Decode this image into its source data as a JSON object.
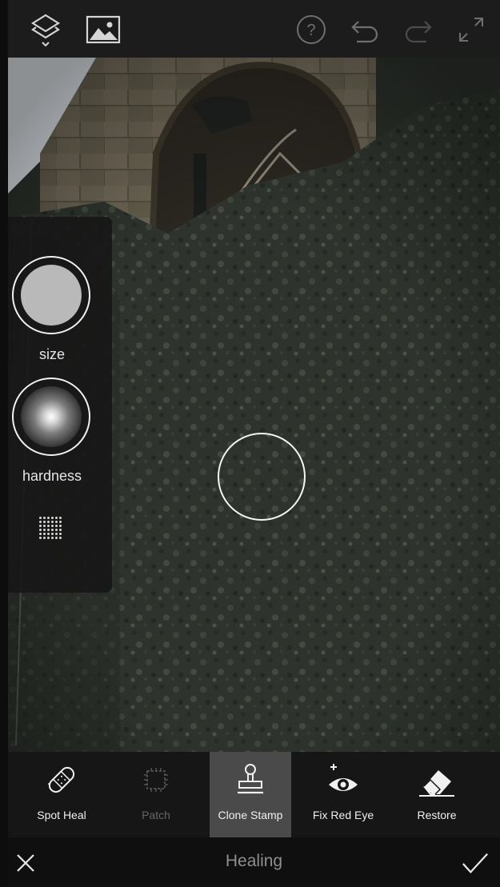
{
  "topbar": {
    "icons": [
      "layers-icon",
      "image-icon",
      "help-icon",
      "undo-icon",
      "redo-icon",
      "expand-icon"
    ]
  },
  "brush_panel": {
    "size_label": "size",
    "hardness_label": "hardness"
  },
  "tools": [
    {
      "label": "Spot Heal",
      "icon": "bandage-icon",
      "state": "normal"
    },
    {
      "label": "Patch",
      "icon": "patch-icon",
      "state": "disabled"
    },
    {
      "label": "Clone Stamp",
      "icon": "stamp-icon",
      "state": "active"
    },
    {
      "label": "Fix Red Eye",
      "icon": "eye-plus-icon",
      "state": "normal"
    },
    {
      "label": "Restore",
      "icon": "eraser-icon",
      "state": "normal"
    }
  ],
  "bottombar": {
    "title": "Healing",
    "cancel_icon": "close-icon",
    "confirm_icon": "checkmark-icon"
  },
  "colors": {
    "bar_background": "#1c1c1c",
    "active_tool": "#4a4a4a",
    "title_text": "#8f8f8f"
  }
}
